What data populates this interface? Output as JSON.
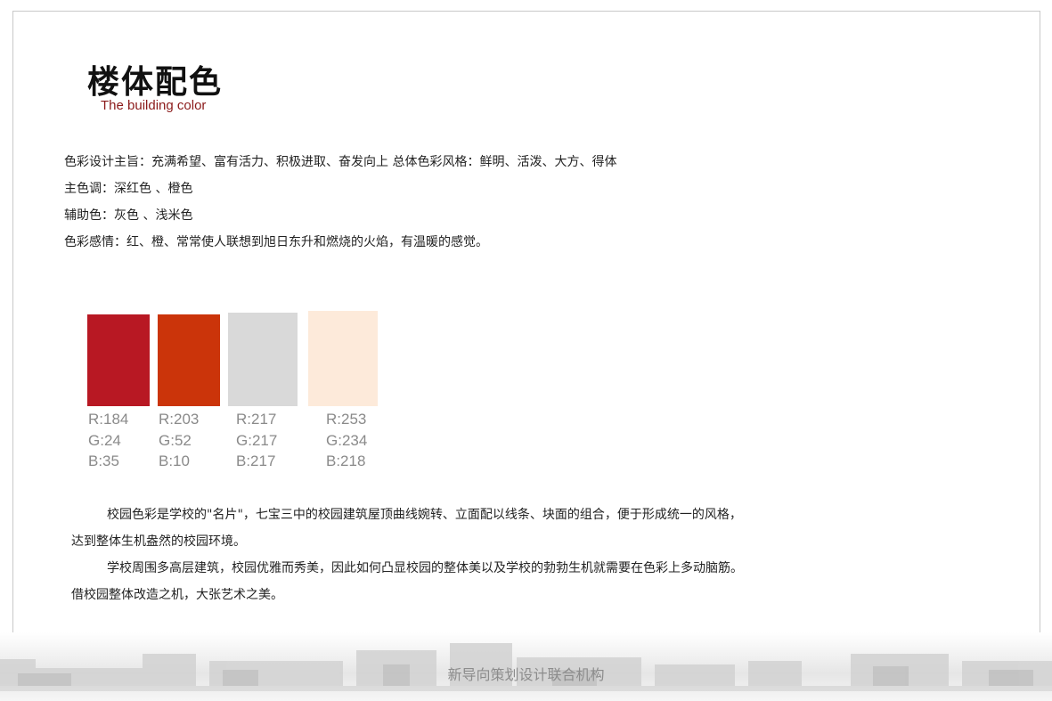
{
  "header": {
    "title": "楼体配色",
    "subtitle": "The building color"
  },
  "intro_lines": [
    "色彩设计主旨：充满希望、富有活力、积极进取、奋发向上 总体色彩风格：鲜明、活泼、大方、得体",
    "主色调：深红色 、橙色",
    "辅助色：灰色 、浅米色",
    "色彩感情：红、橙、常常使人联想到旭日东升和燃烧的火焰，有温暖的感觉。"
  ],
  "swatches": [
    {
      "color": "#B81823",
      "r": "R:184",
      "g": "G:24",
      "b": "B:35"
    },
    {
      "color": "#CB340A",
      "r": "R:203",
      "g": "G:52",
      "b": "B:10"
    },
    {
      "color": "#D9D9D9",
      "r": "R:217",
      "g": "G:217",
      "b": "B:217"
    },
    {
      "color": "#FDEADA",
      "r": "R:253",
      "g": "G:234",
      "b": "B:218"
    }
  ],
  "body_lines": [
    "校园色彩是学校的\"名片\"，七宝三中的校园建筑屋顶曲线婉转、立面配以线条、块面的组合，便于形成统一的风格，",
    "达到整体生机盎然的校园环境。",
    "学校周围多高层建筑，校园优雅而秀美，因此如何凸显校园的整体美以及学校的勃勃生机就需要在色彩上多动脑筋。",
    "借校园整体改造之机，大张艺术之美。"
  ],
  "footer": {
    "org": "新导向策划设计联合机构"
  }
}
